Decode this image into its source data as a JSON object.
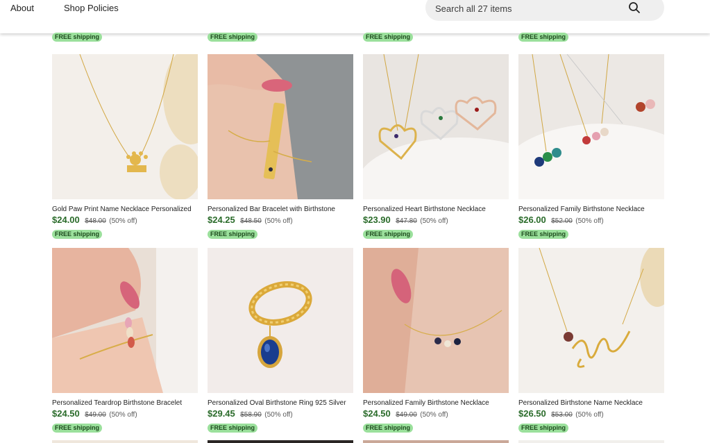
{
  "header": {
    "nav": [
      "About",
      "Shop Policies"
    ],
    "search_placeholder": "Search all 27 items"
  },
  "prev_row_badge": "FREE shipping",
  "listings": [
    {
      "title": "Gold Paw Print Name Necklace Personalized",
      "price": "$24.00",
      "original": "$48.00",
      "discount": "(50% off)",
      "badge": "FREE shipping",
      "image": "paw-necklace"
    },
    {
      "title": "Personalized Bar Bracelet with Birthstone",
      "price": "$24.25",
      "original": "$48.50",
      "discount": "(50% off)",
      "badge": "FREE shipping",
      "image": "bar-bracelet"
    },
    {
      "title": "Personalized Heart Birthstone Necklace",
      "price": "$23.90",
      "original": "$47.80",
      "discount": "(50% off)",
      "badge": "FREE shipping",
      "image": "heart-necklace"
    },
    {
      "title": "Personalized Family Birthstone Necklace",
      "price": "$26.00",
      "original": "$52.00",
      "discount": "(50% off)",
      "badge": "FREE shipping",
      "image": "family-necklace"
    },
    {
      "title": "Personalized Teardrop Birthstone Bracelet",
      "price": "$24.50",
      "original": "$49.00",
      "discount": "(50% off)",
      "badge": "FREE shipping",
      "image": "teardrop-bracelet"
    },
    {
      "title": "Personalized Oval Birthstone Ring 925 Silver",
      "price": "$29.45",
      "original": "$58.90",
      "discount": "(50% off)",
      "badge": "FREE shipping",
      "image": "oval-ring"
    },
    {
      "title": "Personalized Family Birthstone Necklace",
      "price": "$24.50",
      "original": "$49.00",
      "discount": "(50% off)",
      "badge": "FREE shipping",
      "image": "birthstone-necklace"
    },
    {
      "title": "Personalized Birthstone Name Necklace",
      "price": "$26.50",
      "original": "$53.00",
      "discount": "(50% off)",
      "badge": "FREE shipping",
      "image": "name-necklace"
    }
  ],
  "colors": {
    "price": "#2a6b2a",
    "badge_bg": "#9be09c",
    "search_bg": "#efefef"
  }
}
